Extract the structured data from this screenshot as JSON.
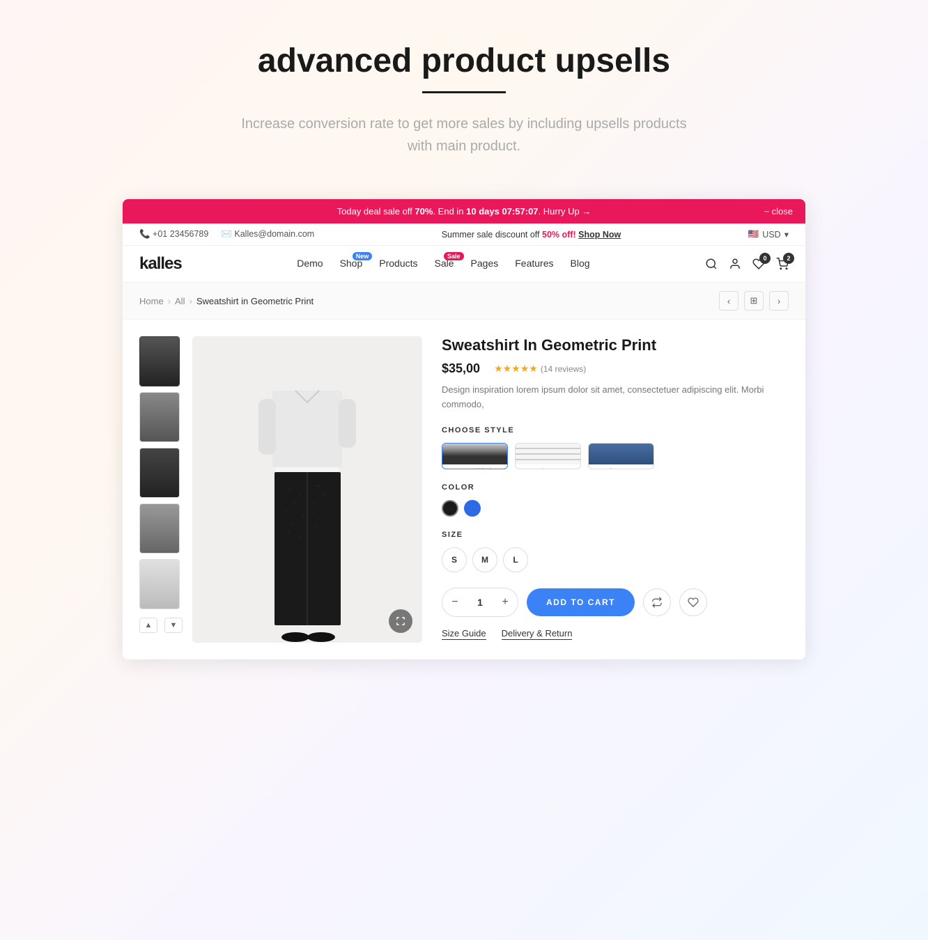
{
  "page": {
    "title": "advanced product upsells",
    "subtitle": "Increase conversion rate to get more sales by including upsells products with main product."
  },
  "announcement": {
    "text_before": "Today deal sale off ",
    "discount": "70%",
    "text_mid": ". End in ",
    "days": "10 days",
    "timer": "07:57:07",
    "text_after": ". Hurry Up →",
    "close_label": "~ close"
  },
  "topbar": {
    "phone": "+01 23456789",
    "email": "Kalles@domain.com",
    "sale_text": "Summer sale discount off ",
    "sale_pct": "50% off!",
    "shop_now": "Shop Now",
    "currency": "USD",
    "flag": "🇺🇸"
  },
  "nav": {
    "logo": "kalles",
    "links": [
      {
        "label": "Demo",
        "badge": null
      },
      {
        "label": "Shop",
        "badge": "New"
      },
      {
        "label": "Products",
        "badge": null
      },
      {
        "label": "Sale",
        "badge": "Sale"
      },
      {
        "label": "Pages",
        "badge": null
      },
      {
        "label": "Features",
        "badge": null
      },
      {
        "label": "Blog",
        "badge": null
      }
    ],
    "cart_count": "2",
    "wishlist_count": "0"
  },
  "breadcrumb": {
    "home": "Home",
    "all": "All",
    "current": "Sweatshirt in Geometric Print"
  },
  "product": {
    "title": "Sweatshirt In Geometric Print",
    "price": "$35,00",
    "rating": 4.5,
    "review_count": "14 reviews",
    "description": "Design inspiration lorem ipsum dolor sit amet, consectetuer adipiscing elit. Morbi commodo,",
    "choose_style_label": "CHOOSE STYLE",
    "styles": [
      {
        "name": "Sweatshirt in Geometric Print",
        "type": "black"
      },
      {
        "name": "Combat Long Sleeve",
        "type": "stripe"
      },
      {
        "name": "Blue Jean",
        "type": "jeans"
      }
    ],
    "color_label": "COLOR",
    "colors": [
      {
        "hex": "#1a1a1a",
        "selected": true
      },
      {
        "hex": "#2d6be4",
        "selected": false
      }
    ],
    "size_label": "SIZE",
    "sizes": [
      "S",
      "M",
      "L"
    ],
    "quantity": "1",
    "add_to_cart": "ADD TO CART",
    "size_guide": "Size Guide",
    "delivery_return": "Delivery & Return"
  },
  "thumbnails": [
    {
      "type": "black",
      "active": true
    },
    {
      "type": "gray",
      "active": false
    },
    {
      "type": "dark",
      "active": false
    },
    {
      "type": "light-gray",
      "active": false
    },
    {
      "type": "white-jeans",
      "active": false
    }
  ]
}
